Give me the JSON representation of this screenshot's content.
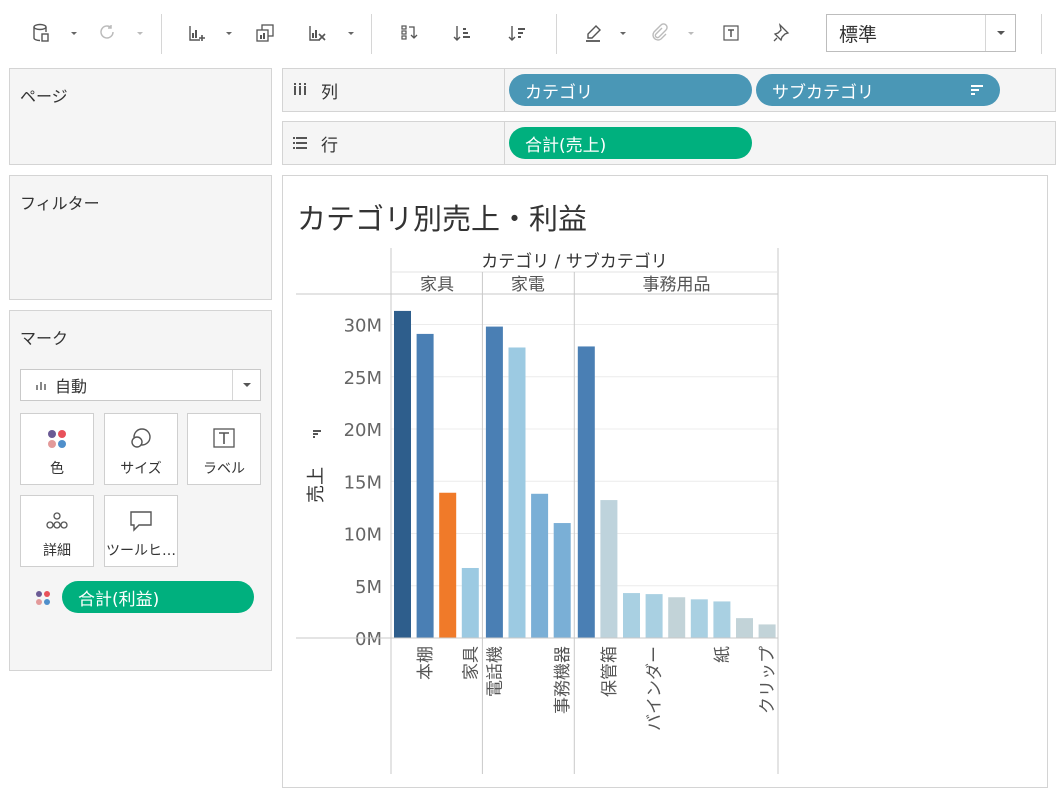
{
  "toolbar": {
    "view_select": "標準"
  },
  "shelves": {
    "pages_title": "ページ",
    "filters_title": "フィルター",
    "columns_label": "列",
    "rows_label": "行",
    "columns_pills": [
      "カテゴリ",
      "サブカテゴリ"
    ],
    "rows_pills": [
      "合計(売上)"
    ]
  },
  "marks": {
    "title": "マーク",
    "type": "自動",
    "cards": [
      "色",
      "サイズ",
      "ラベル",
      "詳細",
      "ツールヒ…"
    ],
    "color_pill": "合計(利益)"
  },
  "viz": {
    "title": "カテゴリ別売上・利益",
    "header": "カテゴリ / サブカテゴリ"
  },
  "chart_data": {
    "type": "bar",
    "title": "カテゴリ別売上・利益",
    "xlabel": "カテゴリ / サブカテゴリ",
    "ylabel": "売上",
    "ylim": [
      0,
      33000000
    ],
    "y_ticks": [
      "0M",
      "5M",
      "10M",
      "15M",
      "20M",
      "25M",
      "30M"
    ],
    "y_tick_values": [
      0,
      5000000,
      10000000,
      15000000,
      20000000,
      25000000,
      30000000
    ],
    "groups": [
      {
        "name": "家具",
        "bars": [
          {
            "label": "",
            "value": 31300000,
            "color": "#2e5e8c"
          },
          {
            "label": "本棚",
            "value": 29100000,
            "color": "#4a7fb4"
          },
          {
            "label": "",
            "value": 13900000,
            "color": "#f07a29"
          },
          {
            "label": "家具",
            "value": 6700000,
            "color": "#9ccae2"
          }
        ]
      },
      {
        "name": "家電",
        "bars": [
          {
            "label": "電話機",
            "value": 29800000,
            "color": "#4a7fb4"
          },
          {
            "label": "",
            "value": 27800000,
            "color": "#9ccae2"
          },
          {
            "label": "",
            "value": 13800000,
            "color": "#7aafd6"
          },
          {
            "label": "事務機器",
            "value": 11000000,
            "color": "#7aafd6"
          }
        ]
      },
      {
        "name": "事務用品",
        "bars": [
          {
            "label": "",
            "value": 27900000,
            "color": "#4a7fb4"
          },
          {
            "label": "保管箱",
            "value": 13200000,
            "color": "#bed3dc"
          },
          {
            "label": "",
            "value": 4300000,
            "color": "#a9d0e2"
          },
          {
            "label": "バインダー",
            "value": 4200000,
            "color": "#a9d0e2"
          },
          {
            "label": "",
            "value": 3900000,
            "color": "#c2d3d8"
          },
          {
            "label": "",
            "value": 3700000,
            "color": "#a9d0e2"
          },
          {
            "label": "紙",
            "value": 3500000,
            "color": "#a9d0e2"
          },
          {
            "label": "",
            "value": 1900000,
            "color": "#c2d3d8"
          },
          {
            "label": "クリップ",
            "value": 1300000,
            "color": "#c2d3d8"
          }
        ]
      }
    ],
    "grid": true,
    "legend": "none"
  }
}
